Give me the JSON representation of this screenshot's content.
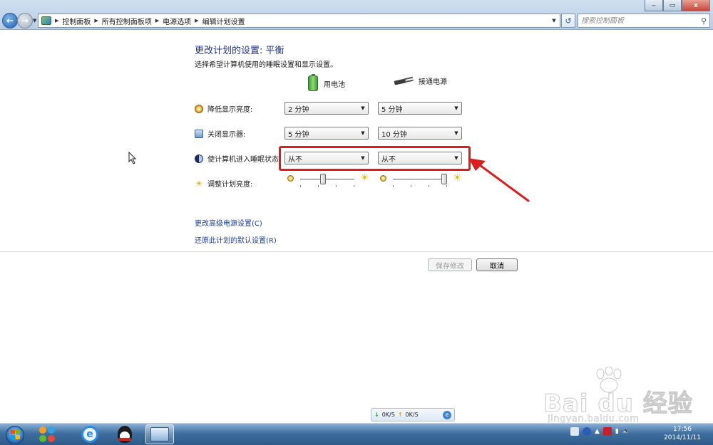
{
  "window": {
    "buttons": [
      "‒",
      "▭",
      "x"
    ]
  },
  "address_bar": {
    "crumbs": [
      "控制面板",
      "所有控制面板项",
      "电源选项",
      "编辑计划设置"
    ],
    "search_placeholder": "搜索控制面板"
  },
  "main": {
    "title": "更改计划的设置: 平衡",
    "subtitle": "选择希望计算机使用的睡眠设置和显示设置。",
    "col_battery": "用电池",
    "col_plugged": "接通电源",
    "rows": [
      {
        "label": "降低显示亮度:",
        "icon": "dim-display-icon",
        "battery": "2 分钟",
        "plugged": "5 分钟"
      },
      {
        "label": "关闭显示器:",
        "icon": "monitor-icon",
        "battery": "5 分钟",
        "plugged": "10 分钟"
      },
      {
        "label": "使计算机进入睡眠状态:",
        "icon": "sleep-icon",
        "battery": "从不",
        "plugged": "从不"
      }
    ],
    "brightness": {
      "label": "调整计划亮度:",
      "battery_level": 0.45,
      "plugged_level": 1.0
    },
    "links": {
      "advanced": "更改高级电源设置(C)",
      "restore": "还原此计划的默认设置(R)"
    },
    "buttons": {
      "save": "保存修改",
      "cancel": "取消"
    }
  },
  "annotation": {
    "highlight_color": "#d81e1e"
  },
  "netspeed": {
    "down": "0K/S",
    "up": "0K/S"
  },
  "watermark": {
    "text": "Bai du 经验",
    "url": "jingyan.baidu.com"
  },
  "taskbar": {
    "time": "17:56",
    "date": "2014/11/11"
  }
}
